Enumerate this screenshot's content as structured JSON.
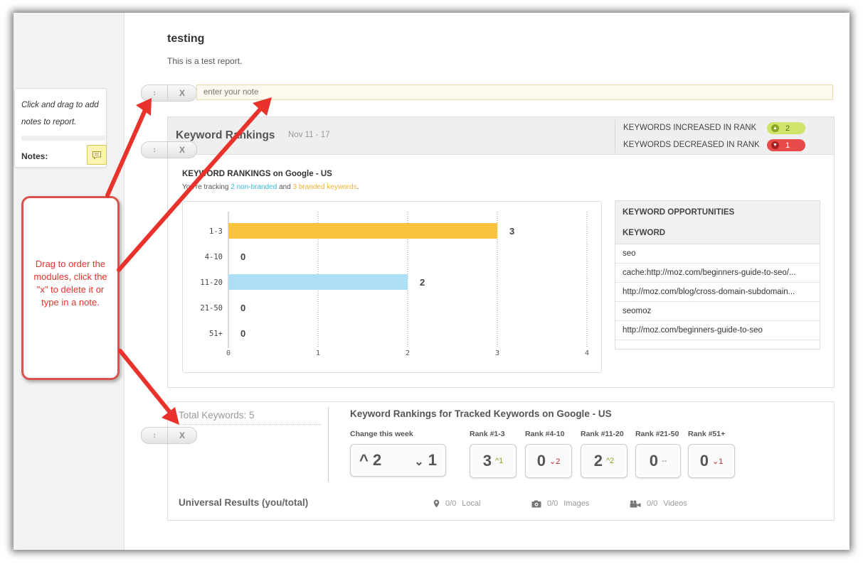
{
  "report": {
    "title": "testing",
    "subtitle": "This is a test report.",
    "note_placeholder": "enter your note"
  },
  "sidebar": {
    "hint": "Click and drag to add notes to report.",
    "notes_label": "Notes:"
  },
  "callout": {
    "text": "Drag to order the modules, click the \"x\" to delete it or type in a note."
  },
  "controls": {
    "drag_glyph": "↕",
    "delete_label": "X"
  },
  "keyword_rankings": {
    "title": "Keyword Rankings",
    "date_range": "Nov 11 - 17",
    "increased_label": "KEYWORDS INCREASED IN RANK",
    "increased_value": "2",
    "decreased_label": "KEYWORDS DECREASED IN RANK",
    "decreased_value": "1",
    "section_title": "KEYWORD RANKINGS on Google - US",
    "tracking_prefix": "You're tracking",
    "tracking_nonbranded": "2 non-branded",
    "tracking_and": "and",
    "tracking_branded": "3 branded keywords",
    "tracking_suffix": ".",
    "opportunities": {
      "title": "KEYWORD OPPORTUNITIES",
      "column": "KEYWORD",
      "keywords": [
        "seo",
        "cache:http://moz.com/beginners-guide-to-seo/...",
        "http://moz.com/blog/cross-domain-subdomain...",
        "seomoz",
        "http://moz.com/beginners-guide-to-seo"
      ]
    }
  },
  "chart_data": {
    "type": "bar",
    "orientation": "horizontal",
    "categories": [
      "1-3",
      "4-10",
      "11-20",
      "21-50",
      "51+"
    ],
    "values": [
      3,
      0,
      2,
      0,
      0
    ],
    "value_labels": [
      "3",
      "0",
      "2",
      "0",
      "0"
    ],
    "bar_colors": [
      "#f8c440",
      "#f8c440",
      "#ade0f6",
      "#ade0f6",
      "#ade0f6"
    ],
    "xlim": [
      0,
      4
    ],
    "x_ticks": [
      "0",
      "1",
      "2",
      "3",
      "4"
    ],
    "grid": "vertical dotted"
  },
  "tracked": {
    "total_label": "Total Keywords: 5",
    "title": "Keyword Rankings for Tracked Keywords on Google - US",
    "change_label": "Change this week",
    "change_up_glyph": "^",
    "change_up": "2",
    "change_down_glyph": "⌄",
    "change_down": "1",
    "ranks": [
      {
        "label": "Rank #1-3",
        "value": "3",
        "delta_glyph": "^",
        "delta": "1",
        "trend": "up"
      },
      {
        "label": "Rank #4-10",
        "value": "0",
        "delta_glyph": "⌄",
        "delta": "2",
        "trend": "down"
      },
      {
        "label": "Rank #11-20",
        "value": "2",
        "delta_glyph": "^",
        "delta": "2",
        "trend": "up"
      },
      {
        "label": "Rank #21-50",
        "value": "0",
        "delta_glyph": "",
        "delta": "--",
        "trend": "neutral"
      },
      {
        "label": "Rank #51+",
        "value": "0",
        "delta_glyph": "⌄",
        "delta": "1",
        "trend": "down"
      }
    ],
    "universal_label": "Universal Results (you/total)",
    "universal": [
      {
        "icon": "map-pin-icon",
        "value": "0/0",
        "label": "Local"
      },
      {
        "icon": "camera-icon",
        "value": "0/0",
        "label": "Images"
      },
      {
        "icon": "video-camera-icon",
        "value": "0/0",
        "label": "Videos"
      }
    ]
  },
  "colors": {
    "annotation_red": "#e8322b",
    "increase_green": "#cfe46a",
    "decrease_red": "#e84a4a",
    "bar_orange": "#f8c440",
    "bar_blue": "#ade0f6"
  }
}
